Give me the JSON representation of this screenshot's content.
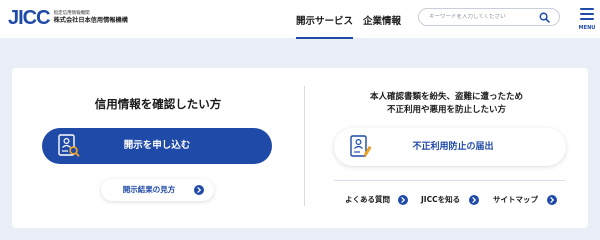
{
  "header": {
    "logo": {
      "mark": "JICC",
      "subtitle": "指定信用情報機関",
      "company": "株式会社日本信用情報機構"
    },
    "nav": [
      {
        "label": "開示サービス",
        "active": true
      },
      {
        "label": "企業情報",
        "active": false
      }
    ],
    "search": {
      "placeholder": "キーワードを入力してください",
      "icon": "search-icon"
    },
    "menu_label": "MENU"
  },
  "left_panel": {
    "title": "信用情報を確認したい方",
    "apply_button": {
      "label": "開示を申し込む",
      "icon": "document-search-icon"
    },
    "howto_link": {
      "label": "開示結果の見方",
      "icon": "circle-arrow-right-icon"
    }
  },
  "right_panel": {
    "title_lines": [
      "本人確認書類を紛失、盗難に遭ったため",
      "不正利用や悪用を防止したい方"
    ],
    "report_button": {
      "label": "不正利用防止の届出",
      "icon": "document-edit-icon"
    },
    "links": [
      {
        "label": "よくある質問"
      },
      {
        "label": "JICCを知る"
      },
      {
        "label": "サイトマップ"
      }
    ]
  },
  "colors": {
    "brand": "#1f4aa8",
    "background": "#e9eef7",
    "card": "#ffffff"
  }
}
